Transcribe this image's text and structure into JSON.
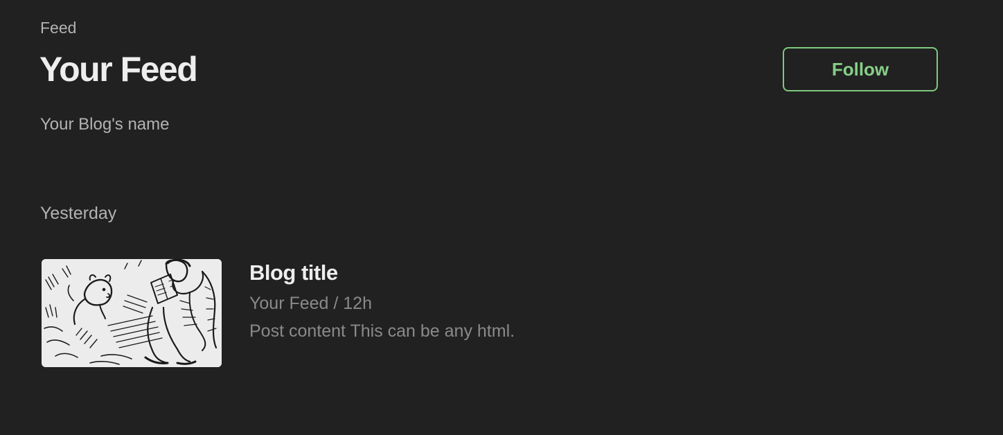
{
  "header": {
    "eyebrow": "Feed",
    "title": "Your Feed",
    "follow_label": "Follow",
    "blog_name": "Your Blog's name"
  },
  "feed": {
    "section_label": "Yesterday",
    "posts": [
      {
        "title": "Blog title",
        "meta": "Your Feed / 12h",
        "content": "Post content This can be any html.",
        "thumbnail_icon": "illustration-thumbnail"
      }
    ]
  },
  "colors": {
    "background": "#212121",
    "accent": "#86cf86",
    "text_primary": "#eeeeee",
    "text_secondary": "#b3b3b3",
    "text_muted": "#8a8a8a"
  }
}
